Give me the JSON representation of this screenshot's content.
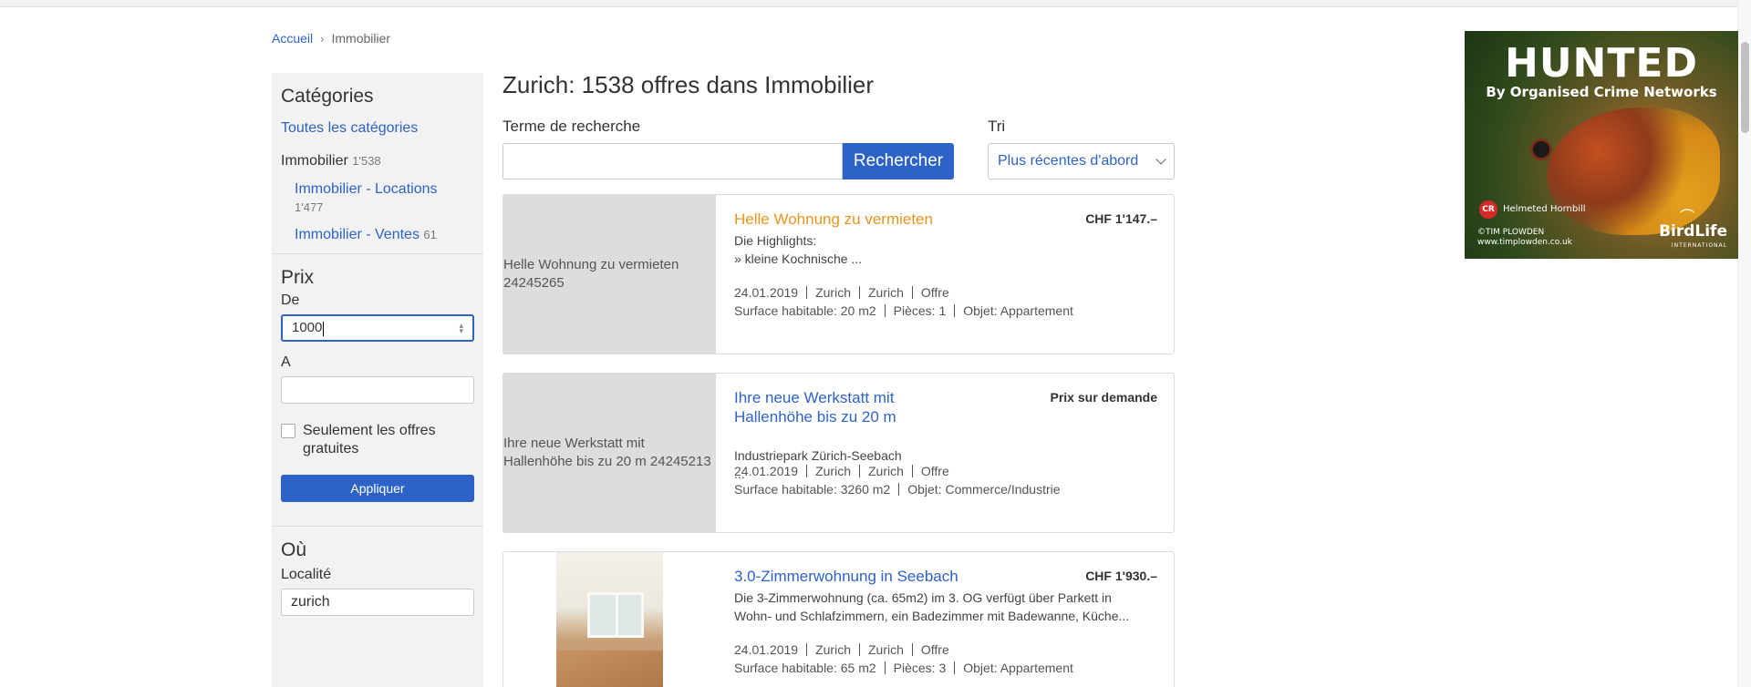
{
  "breadcrumb": {
    "home": "Accueil",
    "separator": "›",
    "current": "Immobilier"
  },
  "sidebar": {
    "categories": {
      "title": "Catégories",
      "all": "Toutes les catégories",
      "parent_label": "Immobilier",
      "parent_count": "1'538",
      "items": [
        {
          "label": "Immobilier - Locations",
          "count": "1'477"
        },
        {
          "label": "Immobilier - Ventes",
          "count": "61"
        }
      ]
    },
    "price": {
      "title": "Prix",
      "from_label": "De",
      "from_value": "1000",
      "to_label": "A",
      "to_value": "",
      "free_only_label": "Seulement les offres gratuites",
      "apply_label": "Appliquer"
    },
    "location": {
      "title": "Où",
      "locality_label": "Localité",
      "locality_value": "zurich"
    }
  },
  "main": {
    "title": "Zurich: 1538 offres dans Immobilier",
    "search_label": "Terme de recherche",
    "search_value": "",
    "search_button": "Rechercher",
    "sort_label": "Tri",
    "sort_value": "Plus récentes d'abord"
  },
  "listings": [
    {
      "title": "Helle Wohnung zu vermieten",
      "title_color": "#e8941d",
      "price": "CHF 1'147.–",
      "image_alt": "Helle Wohnung zu vermieten 24245265",
      "desc_line1": "Die Highlights:",
      "desc_line2": "» kleine Kochnische ...",
      "date": "24.01.2019",
      "city": "Zurich",
      "region": "Zurich",
      "type": "Offre",
      "surface": "Surface habitable: 20 m2",
      "rooms": "Pièces: 1",
      "object": "Objet: Appartement"
    },
    {
      "title": "Ihre neue Werkstatt mit Hallenhöhe bis zu 20 m",
      "title_color": "#2d63c8",
      "price": "Prix sur demande",
      "image_alt": "Ihre neue Werkstatt mit Hallenhöhe bis zu 20 m 24245213",
      "desc_line1": "Industriepark Zürich-Seebach",
      "desc_line2": "...",
      "date": "24.01.2019",
      "city": "Zurich",
      "region": "Zurich",
      "type": "Offre",
      "surface": "Surface habitable: 3260 m2",
      "object": "Objet: Commerce/Industrie"
    },
    {
      "title": "3.0-Zimmerwohnung in Seebach",
      "title_color": "#2d63c8",
      "price": "CHF 1'930.–",
      "desc_line1": "Die 3-Zimmerwohnung (ca. 65m2) im 3. OG verfügt über Parkett in",
      "desc_line2": "Wohn- und Schlafzimmern, ein Badezimmer mit Badewanne, Küche...",
      "date": "24.01.2019",
      "city": "Zurich",
      "region": "Zurich",
      "type": "Offre",
      "surface": "Surface habitable: 65 m2",
      "rooms": "Pièces: 3",
      "object": "Objet: Appartement"
    }
  ],
  "ad": {
    "headline": "HUNTED",
    "subline": "By Organised Crime Networks",
    "badge": "CR",
    "species": "Helmeted Hornbill",
    "credit_line1": "©TIM PLOWDEN",
    "credit_line2": "www.timplowden.co.uk",
    "brand": "BirdLife",
    "brand_sub": "INTERNATIONAL"
  },
  "colors": {
    "link": "#2d63c8",
    "button": "#2d63c8",
    "highlight_title": "#e8941d",
    "sidebar_bg": "#f2f2f2"
  }
}
